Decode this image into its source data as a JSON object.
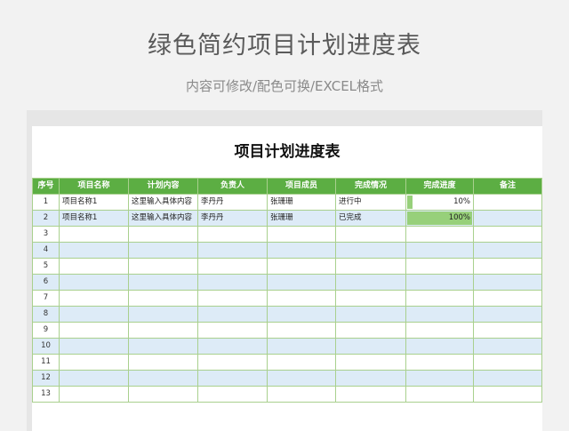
{
  "header": {
    "title": "绿色简约项目计划进度表",
    "subtitle": "内容可修改/配色可换/EXCEL格式"
  },
  "sheet": {
    "title": "项目计划进度表",
    "columns": [
      "序号",
      "项目名称",
      "计划内容",
      "负责人",
      "项目成员",
      "完成情况",
      "完成进度",
      "备注"
    ],
    "rows": [
      {
        "idx": "1",
        "name": "项目名称1",
        "content": "这里输入具体内容",
        "owner": "李丹丹",
        "members": "张珊珊",
        "status": "进行中",
        "progress_label": "10%",
        "progress": 0.1,
        "note": ""
      },
      {
        "idx": "2",
        "name": "项目名称1",
        "content": "这里输入具体内容",
        "owner": "李丹丹",
        "members": "张珊珊",
        "status": "已完成",
        "progress_label": "100%",
        "progress": 1.0,
        "note": ""
      },
      {
        "idx": "3"
      },
      {
        "idx": "4"
      },
      {
        "idx": "5"
      },
      {
        "idx": "6"
      },
      {
        "idx": "7"
      },
      {
        "idx": "8"
      },
      {
        "idx": "9"
      },
      {
        "idx": "10"
      },
      {
        "idx": "11"
      },
      {
        "idx": "12"
      },
      {
        "idx": "13"
      }
    ]
  },
  "colors": {
    "header_green": "#5cae43",
    "progress_fill": "#97d07a",
    "alt_row": "#ddebf7",
    "grid_line": "#a9d08e"
  }
}
